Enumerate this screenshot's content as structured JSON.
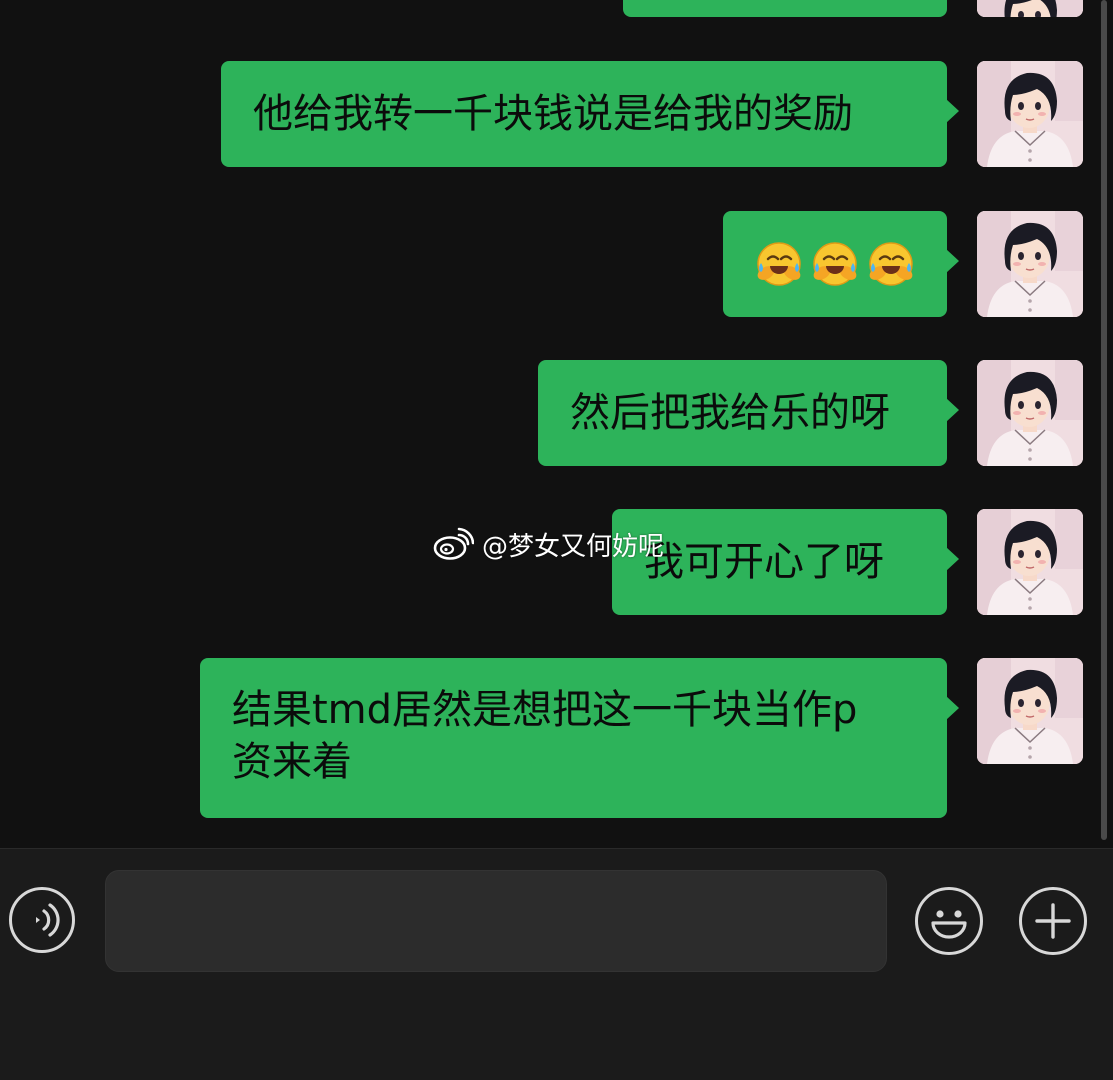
{
  "messages": [
    {
      "text": "他给我转一千块钱说是给我的奖励"
    },
    {
      "emojis": [
        "face-with-tears-of-joy",
        "face-with-tears-of-joy",
        "face-with-tears-of-joy"
      ]
    },
    {
      "text": "然后把我给乐的呀"
    },
    {
      "text": "我可开心了呀"
    },
    {
      "line1": "结果tmd居然是想把这一千块当作p",
      "line2": "资来着"
    }
  ],
  "watermark": {
    "text": "@梦女又何妨呢"
  },
  "input_bar": {
    "voice_icon": "voice-icon",
    "input_value": "",
    "input_placeholder": "",
    "emoji_icon": "smiley-icon",
    "plus_icon": "plus-icon"
  },
  "colors": {
    "background": "#111111",
    "bubble": "#2db35a",
    "input_bar": "#1b1b1b"
  }
}
